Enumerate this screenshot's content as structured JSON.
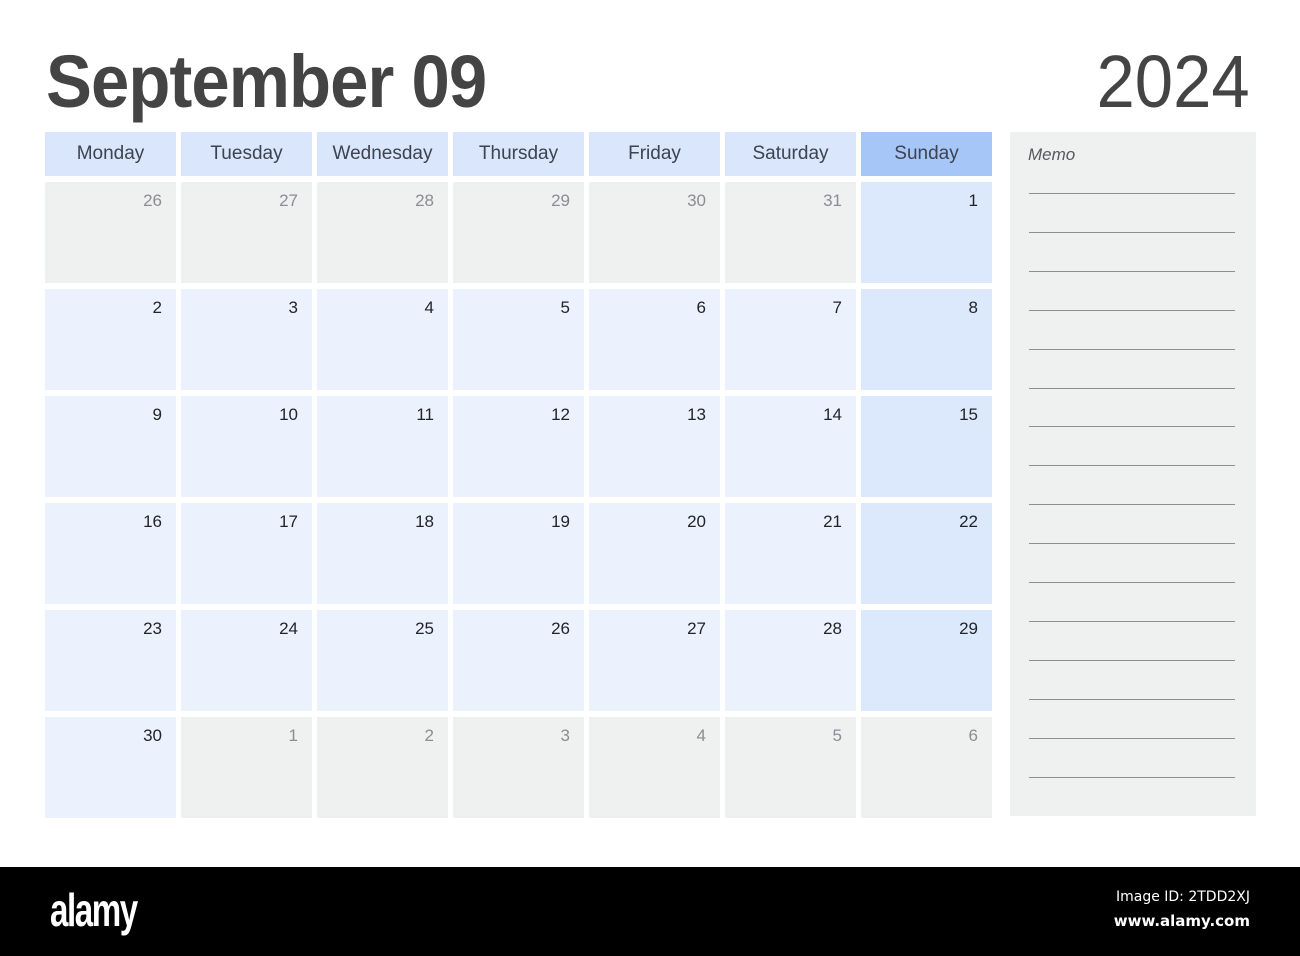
{
  "header": {
    "title": "September 09",
    "year": "2024"
  },
  "calendar": {
    "weekdays": [
      "Monday",
      "Tuesday",
      "Wednesday",
      "Thursday",
      "Friday",
      "Saturday",
      "Sunday"
    ],
    "weeks": [
      [
        {
          "day": "26",
          "current": false
        },
        {
          "day": "27",
          "current": false
        },
        {
          "day": "28",
          "current": false
        },
        {
          "day": "29",
          "current": false
        },
        {
          "day": "30",
          "current": false
        },
        {
          "day": "31",
          "current": false
        },
        {
          "day": "1",
          "current": true
        }
      ],
      [
        {
          "day": "2",
          "current": true
        },
        {
          "day": "3",
          "current": true
        },
        {
          "day": "4",
          "current": true
        },
        {
          "day": "5",
          "current": true
        },
        {
          "day": "6",
          "current": true
        },
        {
          "day": "7",
          "current": true
        },
        {
          "day": "8",
          "current": true
        }
      ],
      [
        {
          "day": "9",
          "current": true
        },
        {
          "day": "10",
          "current": true
        },
        {
          "day": "11",
          "current": true
        },
        {
          "day": "12",
          "current": true
        },
        {
          "day": "13",
          "current": true
        },
        {
          "day": "14",
          "current": true
        },
        {
          "day": "15",
          "current": true
        }
      ],
      [
        {
          "day": "16",
          "current": true
        },
        {
          "day": "17",
          "current": true
        },
        {
          "day": "18",
          "current": true
        },
        {
          "day": "19",
          "current": true
        },
        {
          "day": "20",
          "current": true
        },
        {
          "day": "21",
          "current": true
        },
        {
          "day": "22",
          "current": true
        }
      ],
      [
        {
          "day": "23",
          "current": true
        },
        {
          "day": "24",
          "current": true
        },
        {
          "day": "25",
          "current": true
        },
        {
          "day": "26",
          "current": true
        },
        {
          "day": "27",
          "current": true
        },
        {
          "day": "28",
          "current": true
        },
        {
          "day": "29",
          "current": true
        }
      ],
      [
        {
          "day": "30",
          "current": true
        },
        {
          "day": "1",
          "current": false
        },
        {
          "day": "2",
          "current": false
        },
        {
          "day": "3",
          "current": false
        },
        {
          "day": "4",
          "current": false
        },
        {
          "day": "5",
          "current": false
        },
        {
          "day": "6",
          "current": false
        }
      ]
    ],
    "colors": {
      "weekday_header": "#d9e6fb",
      "sunday_header": "#a6c6f8",
      "current_cell": "#ebf1fd",
      "sunday_cell": "#dce8fc",
      "other_month_cell": "#eff0f0",
      "title_text": "#444444"
    }
  },
  "memo": {
    "label": "Memo",
    "line_count": 16
  },
  "footer": {
    "logo": "alamy",
    "image_id": "Image ID: 2TDD2XJ",
    "site": "www.alamy.com"
  }
}
